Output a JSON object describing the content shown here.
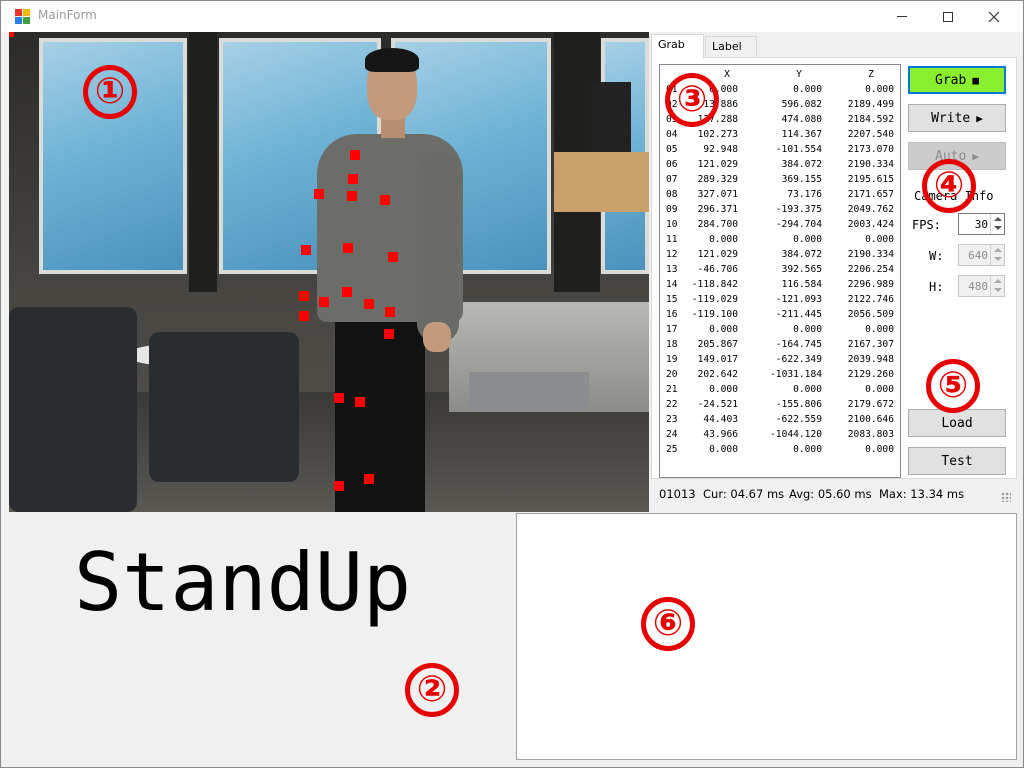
{
  "window": {
    "title": "MainForm",
    "controls": {
      "minimize": "minimize",
      "maximize": "maximize",
      "close": "close"
    }
  },
  "tabs": [
    {
      "label": "Grab",
      "active": true
    },
    {
      "label": "Label",
      "active": false
    }
  ],
  "joints_table": {
    "headers": [
      "",
      "X",
      "Y",
      "Z"
    ],
    "rows": [
      [
        "01",
        "0.000",
        "0.000",
        "0.000"
      ],
      [
        "02",
        "13.886",
        "596.082",
        "2189.499"
      ],
      [
        "03",
        "127.288",
        "474.080",
        "2184.592"
      ],
      [
        "04",
        "102.273",
        "114.367",
        "2207.540"
      ],
      [
        "05",
        "92.948",
        "-101.554",
        "2173.070"
      ],
      [
        "06",
        "121.029",
        "384.072",
        "2190.334"
      ],
      [
        "07",
        "289.329",
        "369.155",
        "2195.615"
      ],
      [
        "08",
        "327.071",
        "73.176",
        "2171.657"
      ],
      [
        "09",
        "296.371",
        "-193.375",
        "2049.762"
      ],
      [
        "10",
        "284.700",
        "-294.704",
        "2003.424"
      ],
      [
        "11",
        "0.000",
        "0.000",
        "0.000"
      ],
      [
        "12",
        "121.029",
        "384.072",
        "2190.334"
      ],
      [
        "13",
        "-46.706",
        "392.565",
        "2206.254"
      ],
      [
        "14",
        "-118.842",
        "116.584",
        "2296.989"
      ],
      [
        "15",
        "-119.029",
        "-121.093",
        "2122.746"
      ],
      [
        "16",
        "-119.100",
        "-211.445",
        "2056.509"
      ],
      [
        "17",
        "0.000",
        "0.000",
        "0.000"
      ],
      [
        "18",
        "205.867",
        "-164.745",
        "2167.307"
      ],
      [
        "19",
        "149.017",
        "-622.349",
        "2039.948"
      ],
      [
        "20",
        "202.642",
        "-1031.184",
        "2129.260"
      ],
      [
        "21",
        "0.000",
        "0.000",
        "0.000"
      ],
      [
        "22",
        "-24.521",
        "-155.806",
        "2179.672"
      ],
      [
        "23",
        "44.403",
        "-622.559",
        "2100.646"
      ],
      [
        "24",
        "43.966",
        "-1044.120",
        "2083.803"
      ],
      [
        "25",
        "0.000",
        "0.000",
        "0.000"
      ]
    ]
  },
  "buttons": {
    "grab": {
      "label": "Grab",
      "glyph": "■",
      "color": "#8aef2e"
    },
    "write": {
      "label": "Write",
      "glyph": "▶"
    },
    "auto": {
      "label": "Auto",
      "glyph": "▶",
      "enabled": false
    },
    "load": {
      "label": "Load"
    },
    "test": {
      "label": "Test"
    }
  },
  "camera_info": {
    "title": "Camera Info",
    "fps_label": "FPS:",
    "fps_value": "30",
    "w_label": "W:",
    "w_value": "640",
    "h_label": "H:",
    "h_value": "480"
  },
  "status_bar": {
    "frame": "01013",
    "cur": "Cur: 04.67 ms",
    "avg": "Avg: 05.60 ms",
    "max": "Max: 13.34 ms"
  },
  "action_label": "StandUp",
  "markers": [
    "①",
    "②",
    "③",
    "④",
    "⑤",
    "⑥"
  ],
  "accent_colors": {
    "marker": "#e60000",
    "joint": "#ff0000",
    "focus": "#0078d7"
  }
}
